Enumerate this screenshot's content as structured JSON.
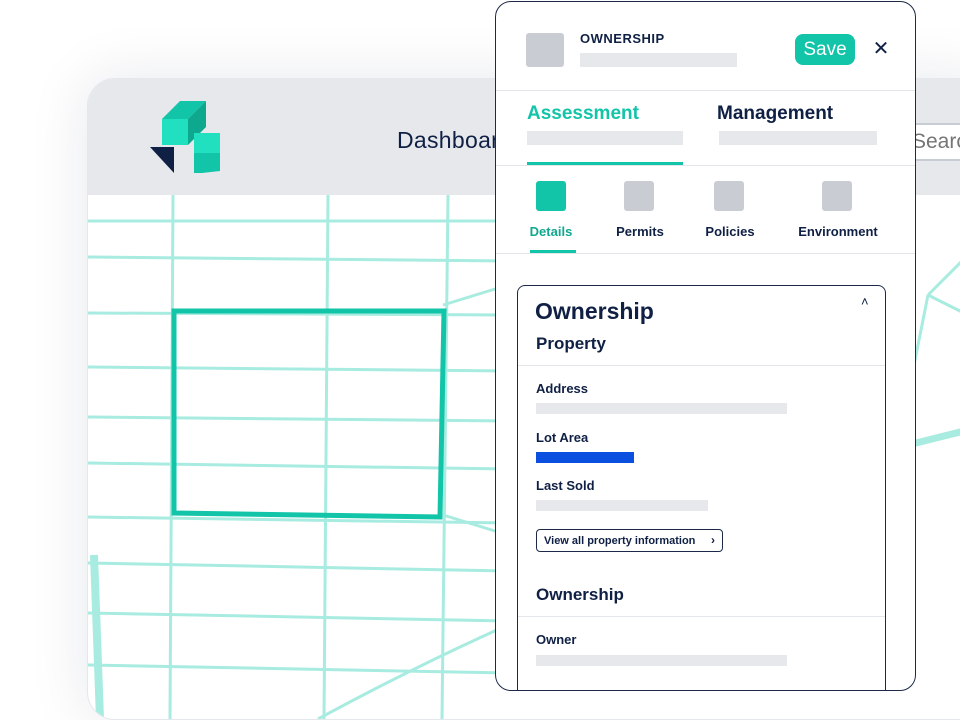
{
  "app": {
    "nav_label": "Dashboard",
    "search_placeholder": "Search"
  },
  "panel": {
    "title": "OWNERSHIP",
    "save_label": "Save",
    "close_glyph": "✕",
    "main_tabs": [
      {
        "label": "Assessment",
        "active": true
      },
      {
        "label": "Management",
        "active": false
      }
    ],
    "sub_tabs": [
      {
        "label": "Details",
        "active": true
      },
      {
        "label": "Permits",
        "active": false
      },
      {
        "label": "Policies",
        "active": false
      },
      {
        "label": "Environment",
        "active": false
      }
    ],
    "card": {
      "title": "Ownership",
      "collapse_glyph": "˄",
      "property_title": "Property",
      "fields": {
        "address": "Address",
        "lot_area": "Lot Area",
        "last_sold": "Last Sold"
      },
      "view_all_label": "View all property information",
      "view_all_chevron": "›",
      "ownership_title": "Ownership",
      "owner_label": "Owner"
    }
  },
  "colors": {
    "accent": "#12c4a8",
    "navy": "#0f2044",
    "highlight_blue": "#0a4fe0",
    "map_line": "#a8ebe0",
    "placeholder": "#e6e8eb"
  },
  "icons": {
    "logo": "brand-logo-icon",
    "close": "close-icon",
    "collapse": "chevron-up-icon",
    "chevron": "chevron-right-icon"
  }
}
